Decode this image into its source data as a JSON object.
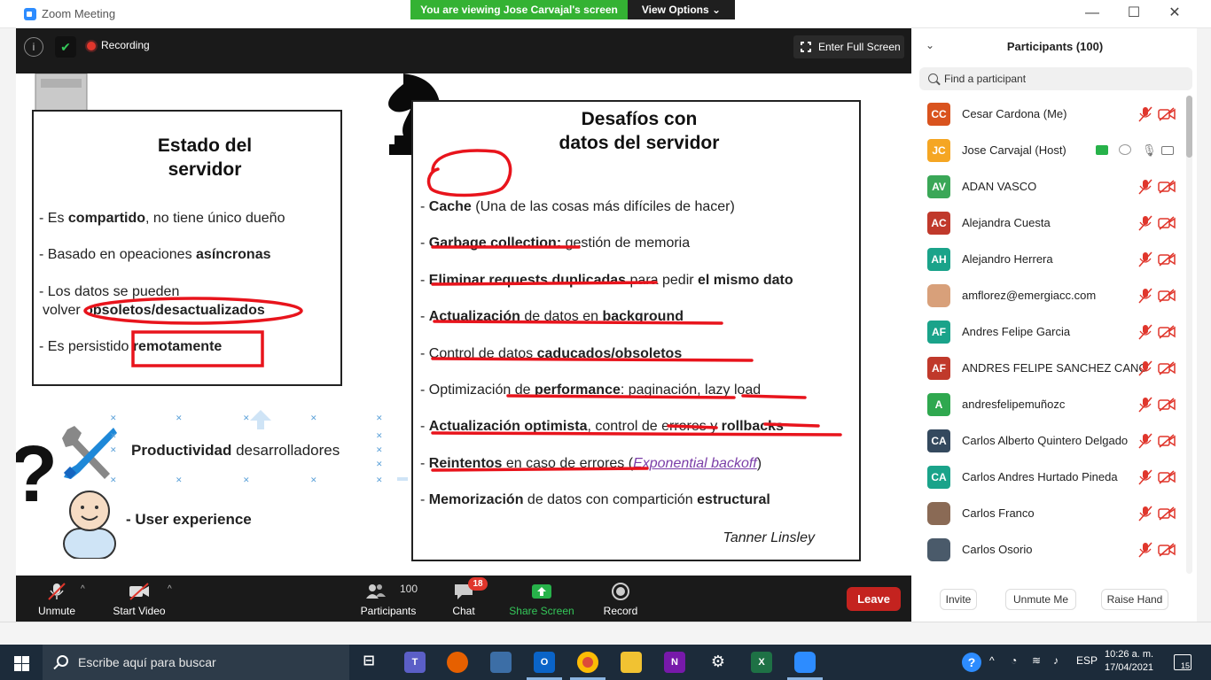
{
  "window": {
    "title": "Zoom Meeting",
    "viewing_banner": "You are viewing Jose Carvajal's screen",
    "view_options": "View Options"
  },
  "meeting_topbar": {
    "recording_label": "Recording",
    "fullscreen_label": "Enter Full Screen"
  },
  "slide": {
    "left_title": "Estado del servidor",
    "left_bullets": [
      {
        "pre": "- Es ",
        "bold": "compartido",
        "post": ", no tiene único dueño"
      },
      {
        "pre": "- Basado en opeaciones ",
        "bold": "asíncronas",
        "post": ""
      },
      {
        "pre": "- Los datos se pueden",
        "bold": "",
        "post": ""
      },
      {
        "pre": "volver ",
        "bold": "obsoletos/desactualizados",
        "post": ""
      },
      {
        "pre": "- Es persistido ",
        "bold": "remotamente",
        "post": ""
      }
    ],
    "right_title": "Desafíos con datos del servidor",
    "right_bullets": [
      {
        "pre": "- ",
        "bold": "Cache",
        "post": " (Una de las cosas más difíciles de hacer)"
      },
      {
        "pre": "- ",
        "bold": "Garbage collection:",
        "post": " gestión de memoria"
      },
      {
        "pre": "- ",
        "bold": "Eliminar requests duplicadas",
        "post": " para pedir ",
        "bold2": "el mismo dato"
      },
      {
        "pre": "- ",
        "bold": "Actualización",
        "post": " de datos en ",
        "bold2": "background"
      },
      {
        "pre": "- Control de datos ",
        "bold": "caducados/obsoletos",
        "post": ""
      },
      {
        "pre": "- Optimización de ",
        "bold": "performance",
        "post": ": paginación, lazy load"
      },
      {
        "pre": "- ",
        "bold": "Actualización optimista",
        "post": ", control de errores y ",
        "bold2": "rollbacks"
      },
      {
        "pre": "- ",
        "bold": "Reintentos",
        "post": " en caso de errores (",
        "link": "Exponential backoff",
        "post2": ")"
      },
      {
        "pre": "- ",
        "bold": "Memorización",
        "post": " de datos con compartición ",
        "bold2": "estructural"
      }
    ],
    "author": "Tanner Linsley",
    "productivity_bold": "Productividad",
    "productivity_rest": " desarrolladores",
    "ux_text": "- User experience"
  },
  "controls": {
    "unmute": "Unmute",
    "start_video": "Start Video",
    "participants_count": "100",
    "participants": "Participants",
    "chat": "Chat",
    "chat_badge": "18",
    "share_screen": "Share Screen",
    "record": "Record",
    "leave": "Leave"
  },
  "participants_panel": {
    "title": "Participants (100)",
    "search_placeholder": "Find a participant",
    "invite": "Invite",
    "unmute_me": "Unmute Me",
    "raise_hand": "Raise Hand",
    "list": [
      {
        "initials": "CC",
        "name": "Cesar Cardona (Me)",
        "color": "#d9531e"
      },
      {
        "initials": "JC",
        "name": "Jose Carvajal (Host)",
        "color": "#f5a623"
      },
      {
        "initials": "AV",
        "name": "ADAN VASCO",
        "color": "#3aa757"
      },
      {
        "initials": "AC",
        "name": "Alejandra Cuesta",
        "color": "#c0392b"
      },
      {
        "initials": "AH",
        "name": "Alejandro Herrera",
        "color": "#1aa38a"
      },
      {
        "initials": "",
        "name": "amflorez@emergiacc.com",
        "color": "#d8a07a"
      },
      {
        "initials": "AF",
        "name": "Andres Felipe Garcia",
        "color": "#1aa38a"
      },
      {
        "initials": "AF",
        "name": "ANDRES FELIPE SANCHEZ CANO",
        "color": "#c0392b"
      },
      {
        "initials": "A",
        "name": "andresfelipemuñozc",
        "color": "#2fa84f"
      },
      {
        "initials": "CA",
        "name": "Carlos Alberto Quintero Delgado",
        "color": "#34495e"
      },
      {
        "initials": "CA",
        "name": "Carlos Andres Hurtado Pineda",
        "color": "#1aa38a"
      },
      {
        "initials": "",
        "name": "Carlos Franco",
        "color": "#8a6a55"
      },
      {
        "initials": "",
        "name": "Carlos Osorio",
        "color": "#4a5a6a"
      }
    ]
  },
  "taskbar": {
    "search_placeholder": "Escribe aquí para buscar",
    "lang": "ESP",
    "time": "10:26 a. m.",
    "date": "17/04/2021",
    "notifications": "15"
  },
  "colors": {
    "zoom_blue": "#2d8cff",
    "banner_green": "#34b233",
    "leave_red": "#c4231f",
    "ink_red": "#e8141c"
  }
}
